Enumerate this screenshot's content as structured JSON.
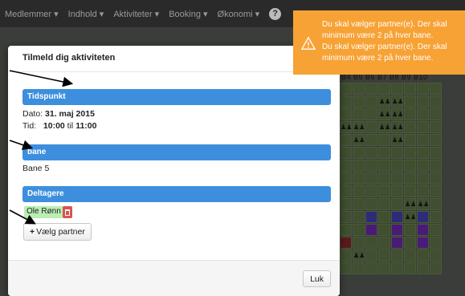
{
  "nav": {
    "items": [
      "Medlemmer ▾",
      "Indhold ▾",
      "Aktiviteter ▾",
      "Booking ▾",
      "Økonomi ▾"
    ]
  },
  "background": {
    "court_header": "B4 B5 B6 B7 B8 B9 B10"
  },
  "modal": {
    "title": "Tilmeld dig aktiviteten",
    "sections": {
      "time": {
        "heading": "Tidspunkt",
        "date_label": "Dato:",
        "date_value": "31. maj 2015",
        "time_label": "Tid:",
        "time_from": "10:00",
        "time_sep": "til",
        "time_to": "11:00"
      },
      "court": {
        "heading": "bane",
        "value": "Bane 5"
      },
      "participants": {
        "heading": "Deltagere",
        "people": [
          "Ole Rønn"
        ],
        "add_partner_label": "Vælg partner"
      }
    },
    "close_label": "Luk"
  },
  "toast": {
    "line1": "Du skal vælger partner(e). Der skal minimum være 2 på hver bane.",
    "line2": "Du skal vælger partner(e). Der skal minimum være 2 på hver bane."
  },
  "colors": {
    "section_bar": "#3d8fde",
    "toast": "#f7a235",
    "delete": "#d9534f",
    "participant_tag": "#b9efb3"
  }
}
